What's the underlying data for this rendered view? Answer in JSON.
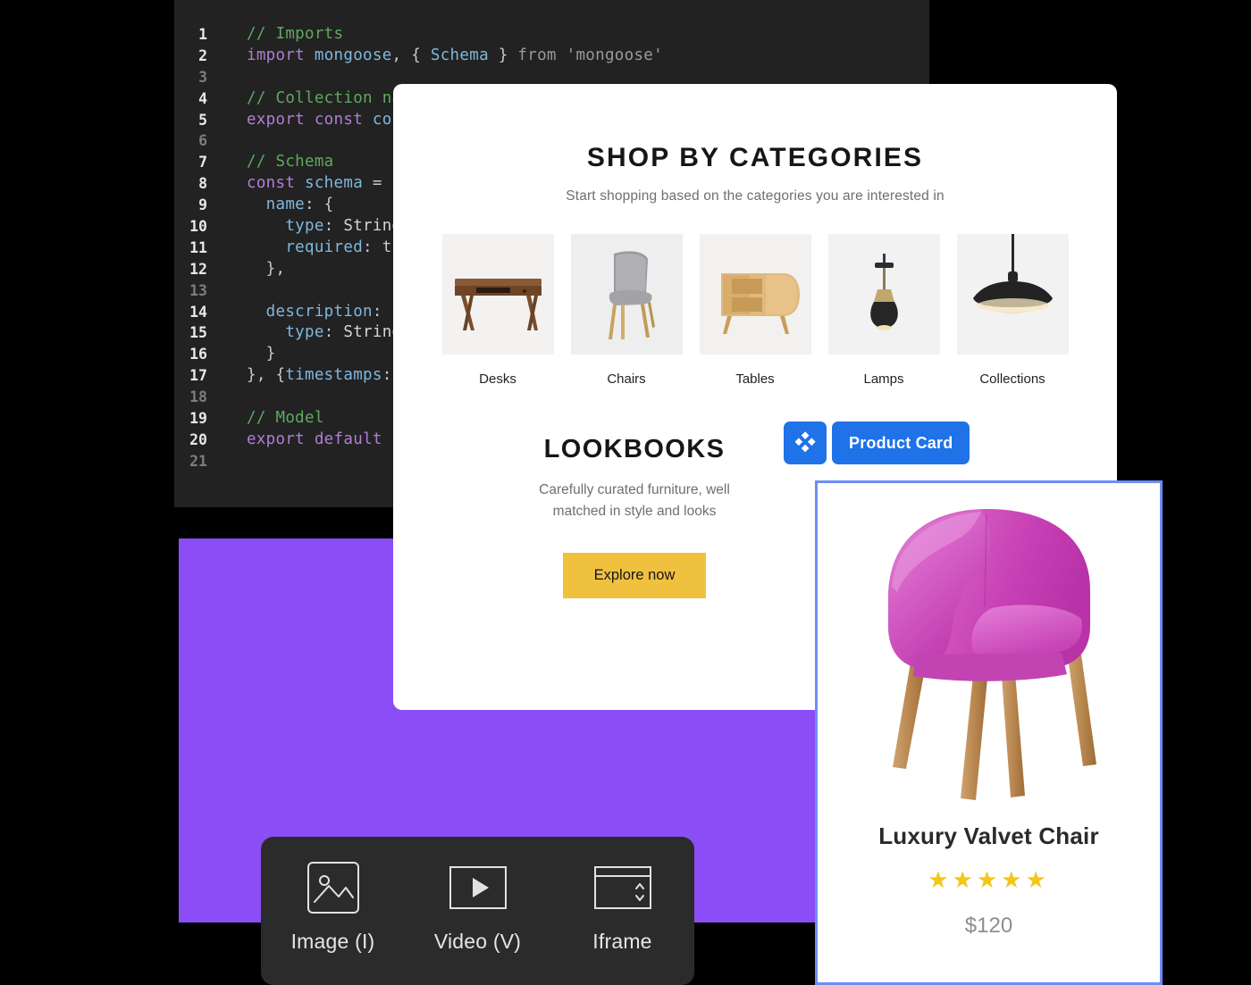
{
  "code_editor": {
    "lines": [
      {
        "n": "1",
        "tokens": [
          {
            "t": "// Imports",
            "c": "t-com"
          }
        ]
      },
      {
        "n": "2",
        "tokens": [
          {
            "t": "import ",
            "c": "t-kw"
          },
          {
            "t": "mongoose",
            "c": "t-var"
          },
          {
            "t": ", { ",
            "c": "t-pun"
          },
          {
            "t": "Schema",
            "c": "t-var"
          },
          {
            "t": " } ",
            "c": "t-pun"
          },
          {
            "t": "from ",
            "c": "t-str"
          },
          {
            "t": "'mongoose'",
            "c": "t-str"
          }
        ]
      },
      {
        "n": "3",
        "tokens": []
      },
      {
        "n": "4",
        "tokens": [
          {
            "t": "// Collection name",
            "c": "t-com"
          }
        ]
      },
      {
        "n": "5",
        "tokens": [
          {
            "t": "export const ",
            "c": "t-kw"
          },
          {
            "t": "collection",
            "c": "t-var"
          }
        ]
      },
      {
        "n": "6",
        "tokens": []
      },
      {
        "n": "7",
        "tokens": [
          {
            "t": "// Schema",
            "c": "t-com"
          }
        ]
      },
      {
        "n": "8",
        "tokens": [
          {
            "t": "const ",
            "c": "t-kw"
          },
          {
            "t": "schema",
            "c": "t-var"
          },
          {
            "t": " = ",
            "c": "t-pun"
          }
        ]
      },
      {
        "n": "9",
        "tokens": [
          {
            "t": "  name",
            "c": "t-prop"
          },
          {
            "t": ": {",
            "c": "t-pun"
          }
        ]
      },
      {
        "n": "10",
        "tokens": [
          {
            "t": "    type",
            "c": "t-prop"
          },
          {
            "t": ": ",
            "c": "t-pun"
          },
          {
            "t": "String",
            "c": "t-plain"
          }
        ]
      },
      {
        "n": "11",
        "tokens": [
          {
            "t": "    required",
            "c": "t-prop"
          },
          {
            "t": ": t",
            "c": "t-pun"
          }
        ]
      },
      {
        "n": "12",
        "tokens": [
          {
            "t": "  },",
            "c": "t-pun"
          }
        ]
      },
      {
        "n": "13",
        "tokens": []
      },
      {
        "n": "14",
        "tokens": [
          {
            "t": "  description",
            "c": "t-prop"
          },
          {
            "t": ":",
            "c": "t-pun"
          }
        ]
      },
      {
        "n": "15",
        "tokens": [
          {
            "t": "    type",
            "c": "t-prop"
          },
          {
            "t": ": ",
            "c": "t-pun"
          },
          {
            "t": "String",
            "c": "t-plain"
          }
        ]
      },
      {
        "n": "16",
        "tokens": [
          {
            "t": "  }",
            "c": "t-pun"
          }
        ]
      },
      {
        "n": "17",
        "tokens": [
          {
            "t": "}, {",
            "c": "t-pun"
          },
          {
            "t": "timestamps",
            "c": "t-prop"
          },
          {
            "t": ":",
            "c": "t-pun"
          }
        ]
      },
      {
        "n": "18",
        "tokens": []
      },
      {
        "n": "19",
        "tokens": [
          {
            "t": "// Model",
            "c": "t-com"
          }
        ]
      },
      {
        "n": "20",
        "tokens": [
          {
            "t": "export default ",
            "c": "t-kw"
          }
        ]
      },
      {
        "n": "21",
        "tokens": []
      }
    ]
  },
  "page": {
    "categories_section": {
      "title": "SHOP BY CATEGORIES",
      "subtitle": "Start shopping based on the categories you are interested in",
      "items": [
        {
          "label": "Desks",
          "art": "desk"
        },
        {
          "label": "Chairs",
          "art": "chair"
        },
        {
          "label": "Tables",
          "art": "sideboard"
        },
        {
          "label": "Lamps",
          "art": "lamp"
        },
        {
          "label": "Collections",
          "art": "pendant"
        }
      ]
    },
    "lookbooks_section": {
      "title": "LOOKBOOKS",
      "subtitle_line1": "Carefully curated furniture, well",
      "subtitle_line2": "matched in style and looks",
      "button_label": "Explore now",
      "button_color": "#f0c03f"
    }
  },
  "badge": {
    "icon": "builder-diamond-icon",
    "label": "Product Card",
    "color": "#1f72e8"
  },
  "product_card": {
    "image_alt": "pink-velvet-armchair",
    "title": "Luxury Valvet Chair",
    "stars": "★★★★★",
    "rating": 5,
    "price": "$120",
    "border_color": "#6d8cf5",
    "star_color": "#f5c518"
  },
  "toolbar": {
    "items": [
      {
        "label": "Image (I)",
        "icon": "image-icon"
      },
      {
        "label": "Video (V)",
        "icon": "video-icon"
      },
      {
        "label": "Iframe",
        "icon": "iframe-icon"
      }
    ],
    "background": "#2b2b2b"
  },
  "panels": {
    "purple_color": "#8b4df5",
    "code_background": "#222222"
  }
}
